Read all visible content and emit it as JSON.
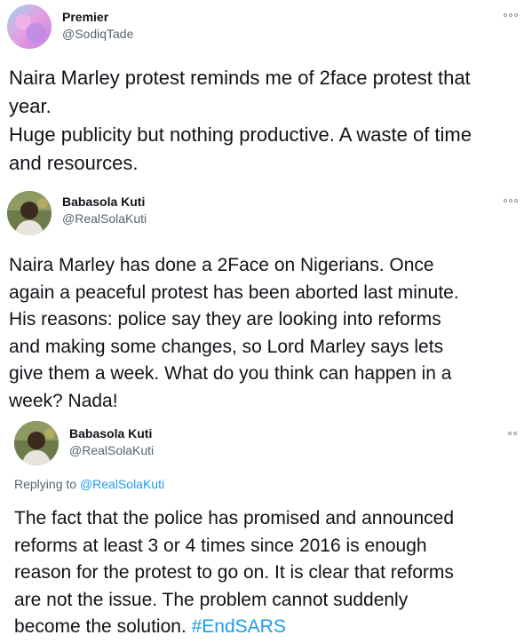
{
  "tweets": [
    {
      "author_name": "Premier",
      "author_handle": "@SodiqTade",
      "more_icon": "more-options-icon",
      "body_lines": [
        "Naira Marley protest reminds me of 2face protest that",
        "year.",
        "Huge publicity but nothing productive. A waste of time",
        "and resources."
      ]
    },
    {
      "author_name": "Babasola Kuti",
      "author_handle": "@RealSolaKuti",
      "more_icon": "more-options-icon",
      "body_lines": [
        "Naira Marley has done a 2Face on Nigerians. Once",
        "again a peaceful protest has been aborted last minute.",
        "His reasons: police say they are looking into reforms",
        "and making some changes, so Lord Marley says lets",
        "give them a week. What do you think can happen in a",
        "week? Nada!"
      ]
    },
    {
      "author_name": "Babasola Kuti",
      "author_handle": "@RealSolaKuti",
      "more_icon": "more-options-icon",
      "replying_prefix": "Replying to ",
      "replying_to": "@RealSolaKuti",
      "body_lines": [
        "The fact that the police has promised and announced",
        "reforms at least 3 or 4 times since 2016 is enough",
        "reason for the protest to go on. It is clear that reforms",
        "are not the issue. The problem cannot suddenly",
        "become the solution. "
      ],
      "hashtag": "#EndSARS"
    }
  ],
  "colors": {
    "text": "#0f1419",
    "secondary": "#536471",
    "link": "#1d9bf0"
  }
}
